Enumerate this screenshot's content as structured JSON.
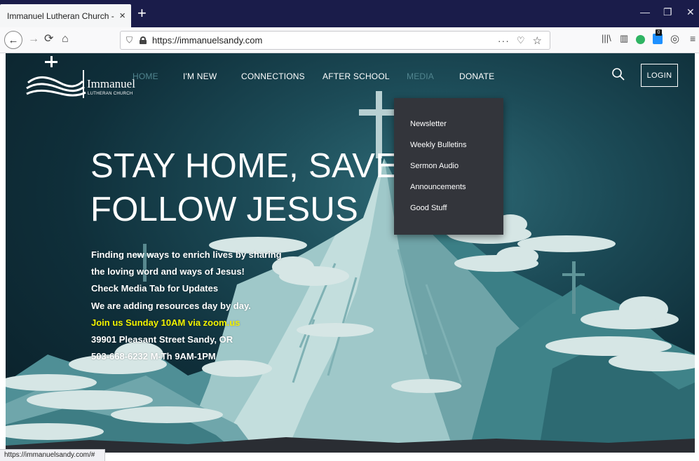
{
  "browser": {
    "tab_title": "Immanuel Lutheran Church - Home",
    "tab_close": "×",
    "new_tab": "+",
    "url": "https://immanuelsandy.com",
    "page_actions": "···",
    "status_url": "https://immanuelsandy.com/#"
  },
  "site": {
    "logo_name": "Immanuel",
    "logo_sub": "LUTHERAN CHURCH",
    "nav": {
      "home": "HOME",
      "im_new": "I'M NEW",
      "connections": "CONNECTIONS",
      "after_school": "AFTER SCHOOL",
      "media": "MEDIA",
      "donate": "DONATE"
    },
    "login_label": "LOGIN",
    "media_menu": [
      "Newsletter",
      "Weekly Bulletins",
      "Sermon Audio",
      "Announcements",
      "Good Stuff"
    ]
  },
  "hero": {
    "title_line1": "STAY HOME, SAVE L",
    "title_line2": "FOLLOW JESUS",
    "lines": [
      "Finding new ways to enrich lives by sharing",
      "the loving word and ways of Jesus!",
      "Check Media Tab for Updates",
      "We are adding resources day by day.",
      "Join us Sunday 10AM via zoom.us",
      "39901 Pleasant Street Sandy, OR",
      "503-668-6232 M-Th 9AM-1PM"
    ]
  },
  "colors": {
    "tabbar": "#1a1c4a",
    "sky": "#1c4b57",
    "dropdown": "#33353b",
    "highlight_text": "#f2f200",
    "dim_menu": "#51858f"
  }
}
